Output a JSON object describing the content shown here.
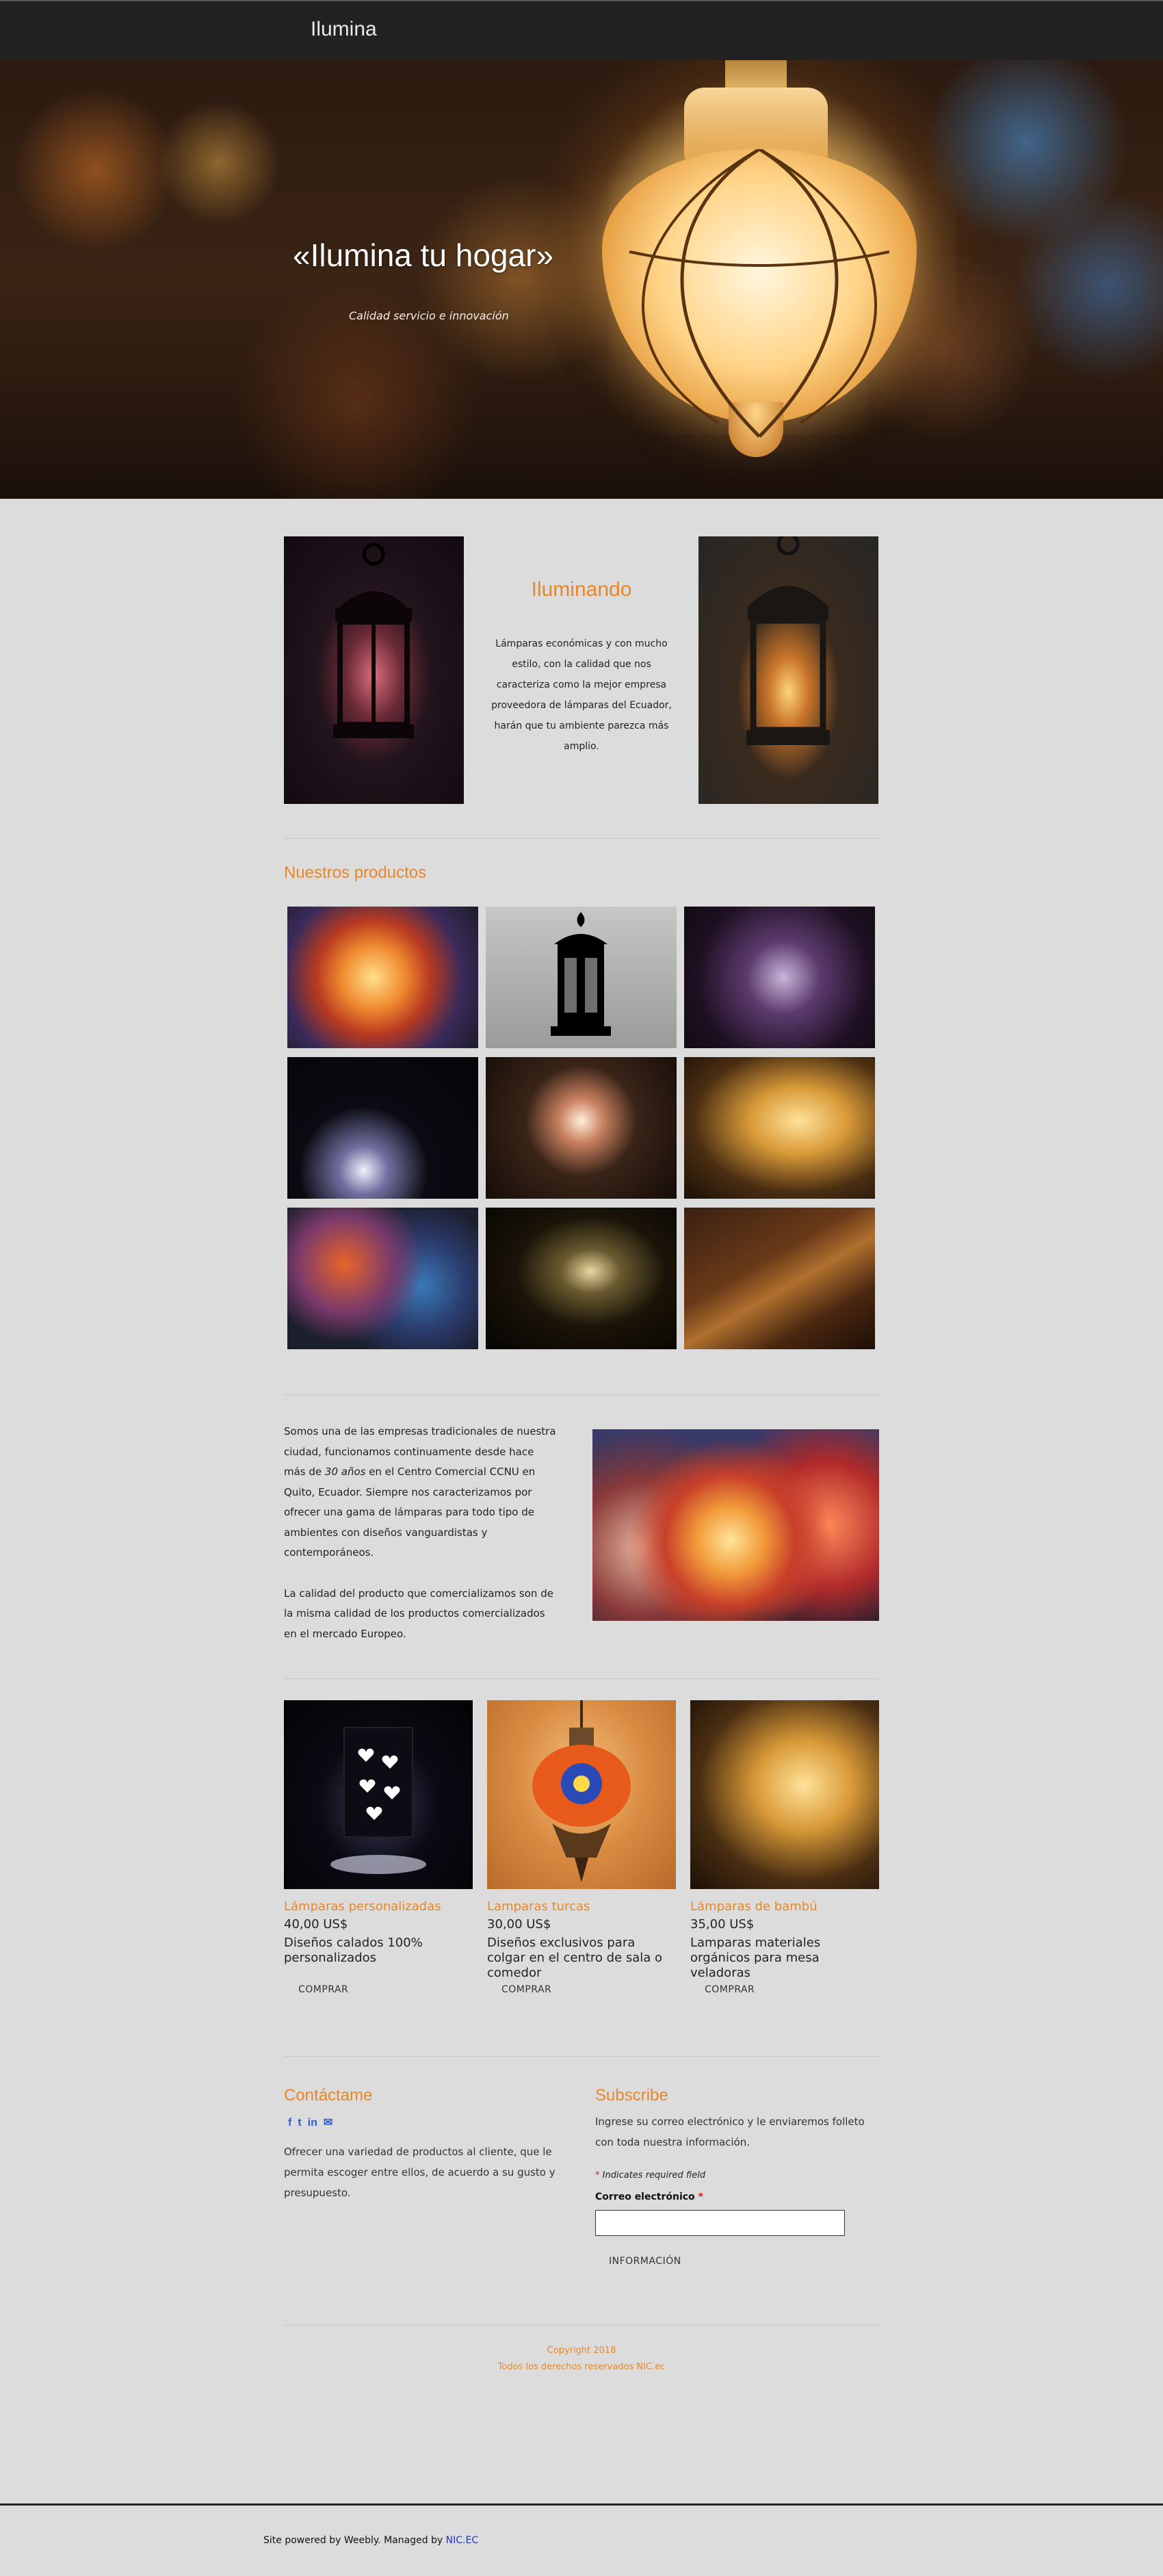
{
  "header": {
    "logo": "Ilumina"
  },
  "hero": {
    "title": "«Ilumina tu hogar»",
    "subtitle": "Calidad servicio e innovación"
  },
  "intro": {
    "title": "Iluminando",
    "text": "Lámparas económicas y con mucho estilo, con la calidad que nos caracteriza como la mejor empresa proveedora de lámparas del Ecuador, harán que tu ambiente parezca más amplio."
  },
  "products_gallery": {
    "title": "Nuestros productos",
    "images": [
      "mosaic-lamps",
      "black-lantern",
      "hanging-lantern",
      "heart-cutout-lantern",
      "glowing-lantern-top",
      "bamboo-candles",
      "turkish-mosaic-lamps",
      "desk-lamp-scene",
      "wood-table-lantern"
    ]
  },
  "about": {
    "p1_before": "Somos una de las empresas tradicionales de nuestra ciudad, funcionamos continuamente desde hace más de ",
    "p1_years": "30 años",
    "p1_after": " en el Centro Comercial CCNU en Quito, Ecuador. Siempre nos caracterizamos por ofrecer una gama de lámparas para todo tipo de ambientes con diseños vanguardistas y contemporáneos.",
    "p2": "La calidad del producto que comercializamos son de la misma calidad de los productos comercializados en el mercado Europeo."
  },
  "products": [
    {
      "name": "Lámparas personalizadas",
      "price": "40,00 US$",
      "desc": "Diseños calados 100% personalizados",
      "button": "COMPRAR"
    },
    {
      "name": "Lamparas turcas",
      "price": "30,00 US$",
      "desc": "Diseños exclusivos para colgar en el centro de sala o comedor",
      "button": "COMPRAR"
    },
    {
      "name": "Lámparas de bambú",
      "price": "35,00 US$",
      "desc": "Lamparas materiales orgánicos para mesa veladoras",
      "button": "COMPRAR"
    }
  ],
  "contact": {
    "title": "Contáctame",
    "social": [
      "f",
      "t",
      "in",
      "✉"
    ],
    "text": "Ofrecer una variedad de productos al cliente, que le permita escoger entre ellos, de acuerdo a su gusto y presupuesto."
  },
  "subscribe": {
    "title": "Subscribe",
    "text": "Ingrese su correo electrónico y le enviaremos folleto con toda nuestra información.",
    "required_note": "Indicates required field",
    "email_label": "Correo electrónico",
    "button": "INFORMACIÓN"
  },
  "copyright": {
    "line1": "Copyright 2018",
    "line2": "Todos los derechos reservados NIC.ec"
  },
  "footer": {
    "text": "Site powered by Weebly. Managed by ",
    "link": "NIC.EC"
  },
  "colors": {
    "accent": "#e8872a",
    "background": "#dcdcdc",
    "header": "#222222",
    "link": "#2233cc"
  }
}
